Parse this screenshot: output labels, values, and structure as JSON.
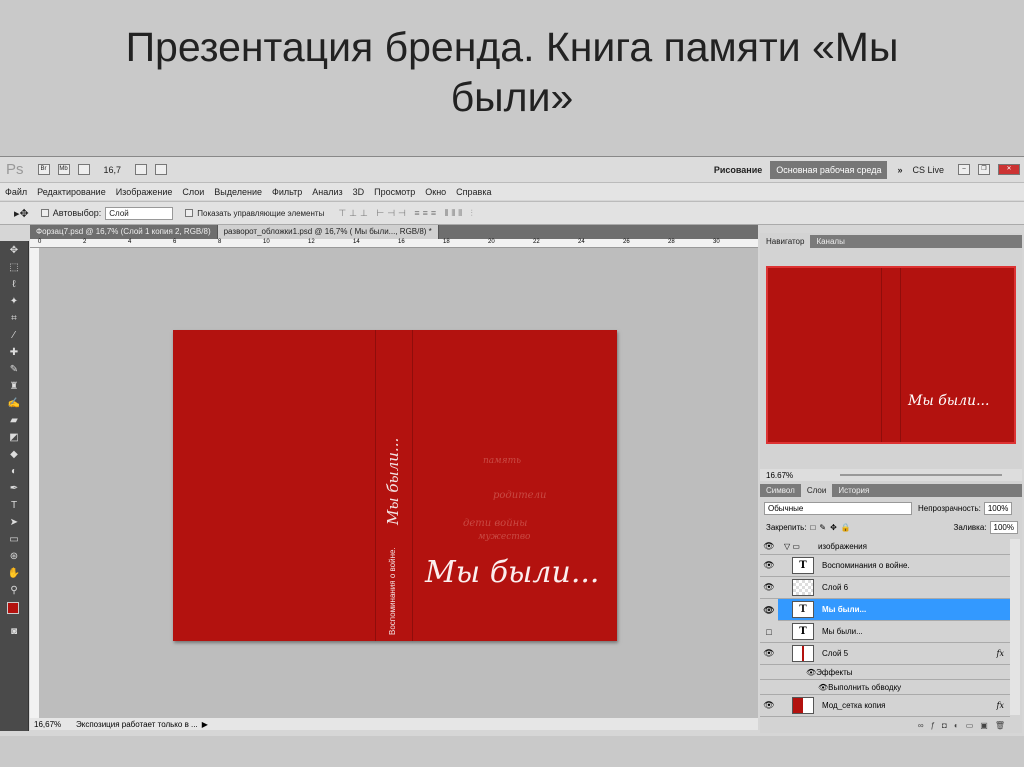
{
  "slide": {
    "title": "Презентация бренда. Книга памяти «Мы были»"
  },
  "appbar": {
    "logo": "Ps",
    "br": "Br",
    "mb": "Mb",
    "zoom": "16,7",
    "workspace_draw": "Рисование",
    "workspace_main": "Основная рабочая среда",
    "more": "»",
    "cslive": "CS Live"
  },
  "menu": [
    "Файл",
    "Редактирование",
    "Изображение",
    "Слои",
    "Выделение",
    "Фильтр",
    "Анализ",
    "3D",
    "Просмотр",
    "Окно",
    "Справка"
  ],
  "options": {
    "autoselect": "Автовыбор:",
    "autoselect_value": "Слой",
    "show_controls": "Показать управляющие элементы"
  },
  "tabs": [
    {
      "label": "Форзац7.psd @ 16,7% (Слой 1 копия 2, RGB/8)"
    },
    {
      "label": "разворот_обложки1.psd @ 16,7% ( Мы были..., RGB/8) *"
    }
  ],
  "ruler": [
    "0",
    "2",
    "4",
    "6",
    "8",
    "10",
    "12",
    "14",
    "16",
    "18",
    "20",
    "22",
    "24",
    "26",
    "28",
    "30"
  ],
  "document": {
    "spine_subtitle": "Воспоминания о войне.",
    "spine_title": "Мы были...",
    "cover_title": "Мы были...",
    "ghost_words": [
      "родители",
      "дети войны",
      "память",
      "мужество"
    ],
    "color": "#b3120f"
  },
  "status": {
    "zoom": "16,67%",
    "text": "Экспозиция работает только в ..."
  },
  "navigator": {
    "tabs": [
      "Навигатор",
      "Каналы"
    ],
    "zoom": "16.67%"
  },
  "layers_panel": {
    "tabs": [
      "Символ",
      "Слои",
      "История"
    ],
    "blend": "Обычные",
    "opacity_label": "Непрозрачность:",
    "opacity": "100%",
    "lock_label": "Закрепить:",
    "fill_label": "Заливка:",
    "fill": "100%",
    "layers": [
      {
        "name": "изображения"
      },
      {
        "name": "Воспоминания о войне."
      },
      {
        "name": "Слой 6"
      },
      {
        "name": "Мы были..."
      },
      {
        "name": "Мы были..."
      },
      {
        "name": "Слой 5"
      },
      {
        "name": "Эффекты"
      },
      {
        "name": "Выполнить обводку"
      },
      {
        "name": "Мод_сетка копия"
      }
    ],
    "fx": "fx"
  }
}
